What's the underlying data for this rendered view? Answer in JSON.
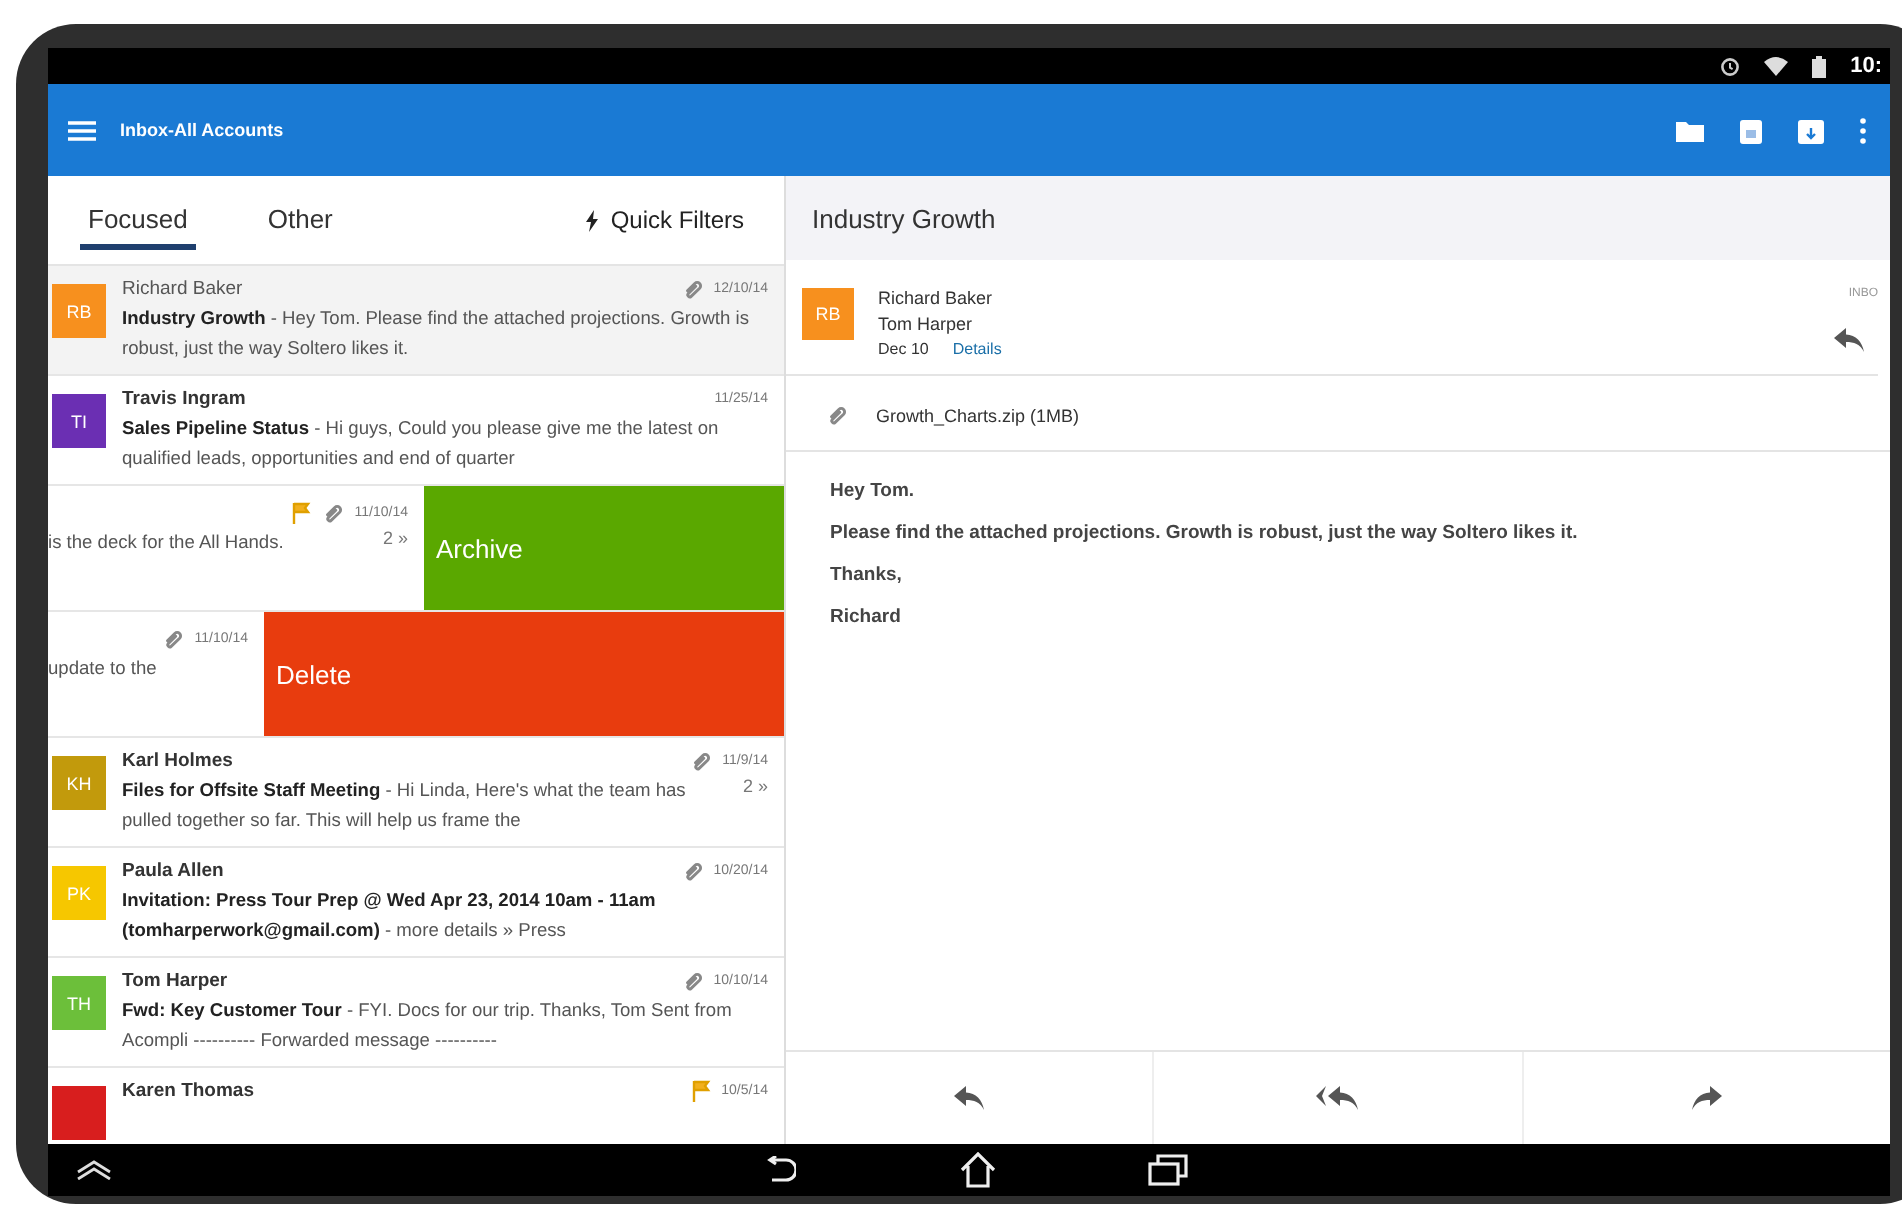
{
  "status_bar": {
    "time": "10:"
  },
  "app_bar": {
    "title": "Inbox-All Accounts"
  },
  "tabs": [
    {
      "label": "Focused",
      "selected": true
    },
    {
      "label": "Other",
      "selected": false
    }
  ],
  "quick_filters": {
    "label": "Quick Filters"
  },
  "messages": [
    {
      "kind": "normal",
      "selected": true,
      "initials": "RB",
      "color": "#f7901e",
      "sender": "Richard Baker",
      "snippet": "**Industry Growth** - Hey Tom. Please find the attached projections. Growth is robust, just the way Soltero likes it.",
      "date": "12/10/14",
      "attachment": true,
      "flagged": false
    },
    {
      "kind": "normal",
      "selected": false,
      "initials": "TI",
      "color": "#6b2fb3",
      "sender": "Travis Ingram",
      "snippet": "**Sales Pipeline Status** - Hi guys, Could you please give me the latest on qualified leads, opportunities and end of quarter",
      "date": "11/25/14",
      "attachment": false,
      "flagged": false
    },
    {
      "kind": "swiped",
      "selected": false,
      "snippet": "is the deck for the All Hands.",
      "date": "11/10/14",
      "attachment": true,
      "flagged": true,
      "count": "2 »",
      "action": {
        "kind": "archive",
        "label": "Archive",
        "color": "#5aa800"
      }
    },
    {
      "kind": "swiped",
      "selected": false,
      "snippet": "update to the",
      "date": "11/10/14",
      "attachment": true,
      "flagged": false,
      "action": {
        "kind": "delete",
        "label": "Delete",
        "color": "#e83c0e"
      }
    },
    {
      "kind": "normal",
      "selected": false,
      "initials": "KH",
      "color": "#c29a0c",
      "sender": "Karl Holmes",
      "snippet": "**Files for Offsite Staff Meeting** - Hi Linda, Here's what the team has pulled together so far. This will help us frame the",
      "date": "11/9/14",
      "attachment": true,
      "flagged": false,
      "count": "2 »"
    },
    {
      "kind": "normal",
      "selected": false,
      "initials": "PK",
      "color": "#f6c700",
      "sender": "Paula Allen",
      "snippet": "**Invitation: Press Tour Prep @ Wed Apr 23, 2014 10am - 11am (tomharperwork@gmail.com)** - more details » Press",
      "date": "10/20/14",
      "attachment": true,
      "flagged": false
    },
    {
      "kind": "normal",
      "selected": false,
      "initials": "TH",
      "color": "#6cbf3a",
      "sender": "Tom Harper",
      "snippet": "**Fwd: Key Customer Tour** - FYI. Docs for our trip. Thanks, Tom Sent from Acompli ---------- Forwarded message ----------",
      "date": "10/10/14",
      "attachment": true,
      "flagged": false
    },
    {
      "kind": "normal",
      "selected": false,
      "color": "#d81e1e",
      "sender": "Karen Thomas",
      "date": "10/5/14",
      "attachment": false,
      "flagged": true
    }
  ],
  "reading": {
    "subject": "Industry Growth",
    "avatar": {
      "initials": "RB",
      "color": "#f7901e"
    },
    "from": "Richard Baker",
    "to": "Tom Harper",
    "date": "Dec 10",
    "details_link": "Details",
    "folder": "INBO",
    "attachment": "Growth_Charts.zip (1MB)",
    "body": [
      "Hey Tom.",
      "Please find the attached projections. Growth is robust, just the way Soltero likes it.",
      "Thanks,",
      "Richard"
    ]
  }
}
